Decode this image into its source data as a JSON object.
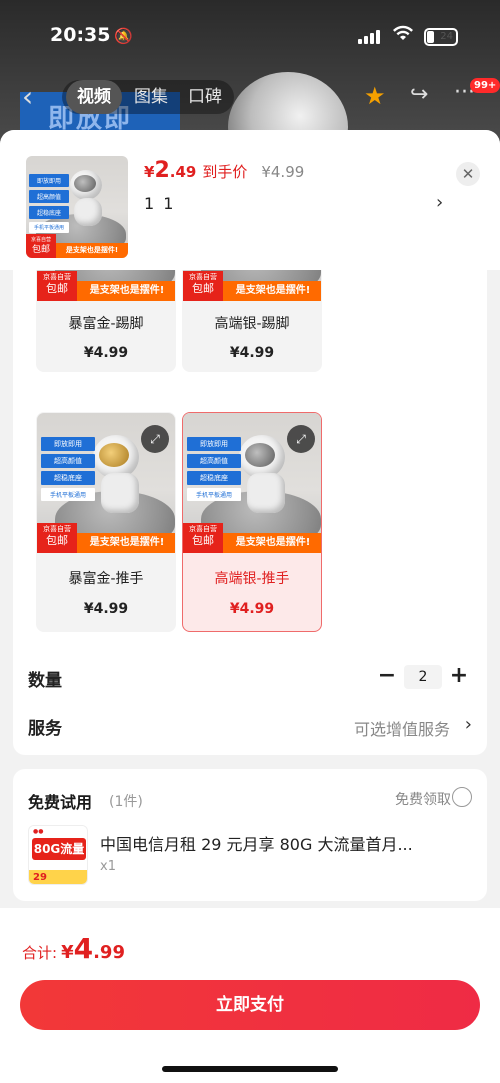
{
  "status_bar": {
    "time": "20:35",
    "battery": "24"
  },
  "top_nav": {
    "tabs": [
      {
        "label": "视频",
        "active": true
      },
      {
        "label": "图集",
        "active": false
      },
      {
        "label": "口碑",
        "active": false
      }
    ],
    "badge": "99+",
    "background_promo": "即放即用"
  },
  "sku_header": {
    "price_currency": "¥",
    "price_integer": "2",
    "price_decimal": ".49",
    "price_label": "到手价",
    "original_price": "¥4.99",
    "selected_spec": "1 1"
  },
  "product_image_text": {
    "tags": [
      "即放即用",
      "超高颜值",
      "超稳底座",
      "手机平板通用"
    ],
    "store": "京喜自营",
    "free_shipping": "包邮",
    "slogan": "是支架也是摆件!"
  },
  "options": [
    {
      "name": "暴富金-踢脚",
      "price": "¥4.99",
      "selected": false,
      "gold": true
    },
    {
      "name": "高端银-踢脚",
      "price": "¥4.99",
      "selected": false,
      "gold": false
    },
    {
      "name": "暴富金-推手",
      "price": "¥4.99",
      "selected": false,
      "gold": true
    },
    {
      "name": "高端银-推手",
      "price": "¥4.99",
      "selected": true,
      "gold": false
    }
  ],
  "quantity": {
    "label": "数量",
    "value": "2",
    "minus": "−",
    "plus": "+"
  },
  "service": {
    "label": "服务",
    "value": "可选增值服务"
  },
  "free_trial": {
    "title": "免费试用",
    "count": "(1件)",
    "claim_label": "免费领取",
    "item_title": "中国电信月租 29 元月享 80G 大流量首月...",
    "item_qty": "x1",
    "thumb_text": "80G流量",
    "thumb_price": "29"
  },
  "footer": {
    "total_label": "合计:",
    "total_currency": "¥",
    "total_integer": "4",
    "total_decimal": ".99",
    "pay_button": "立即支付"
  },
  "colors": {
    "accent": "#e02020",
    "button": "#f23838",
    "orange": "#ff6a00"
  }
}
